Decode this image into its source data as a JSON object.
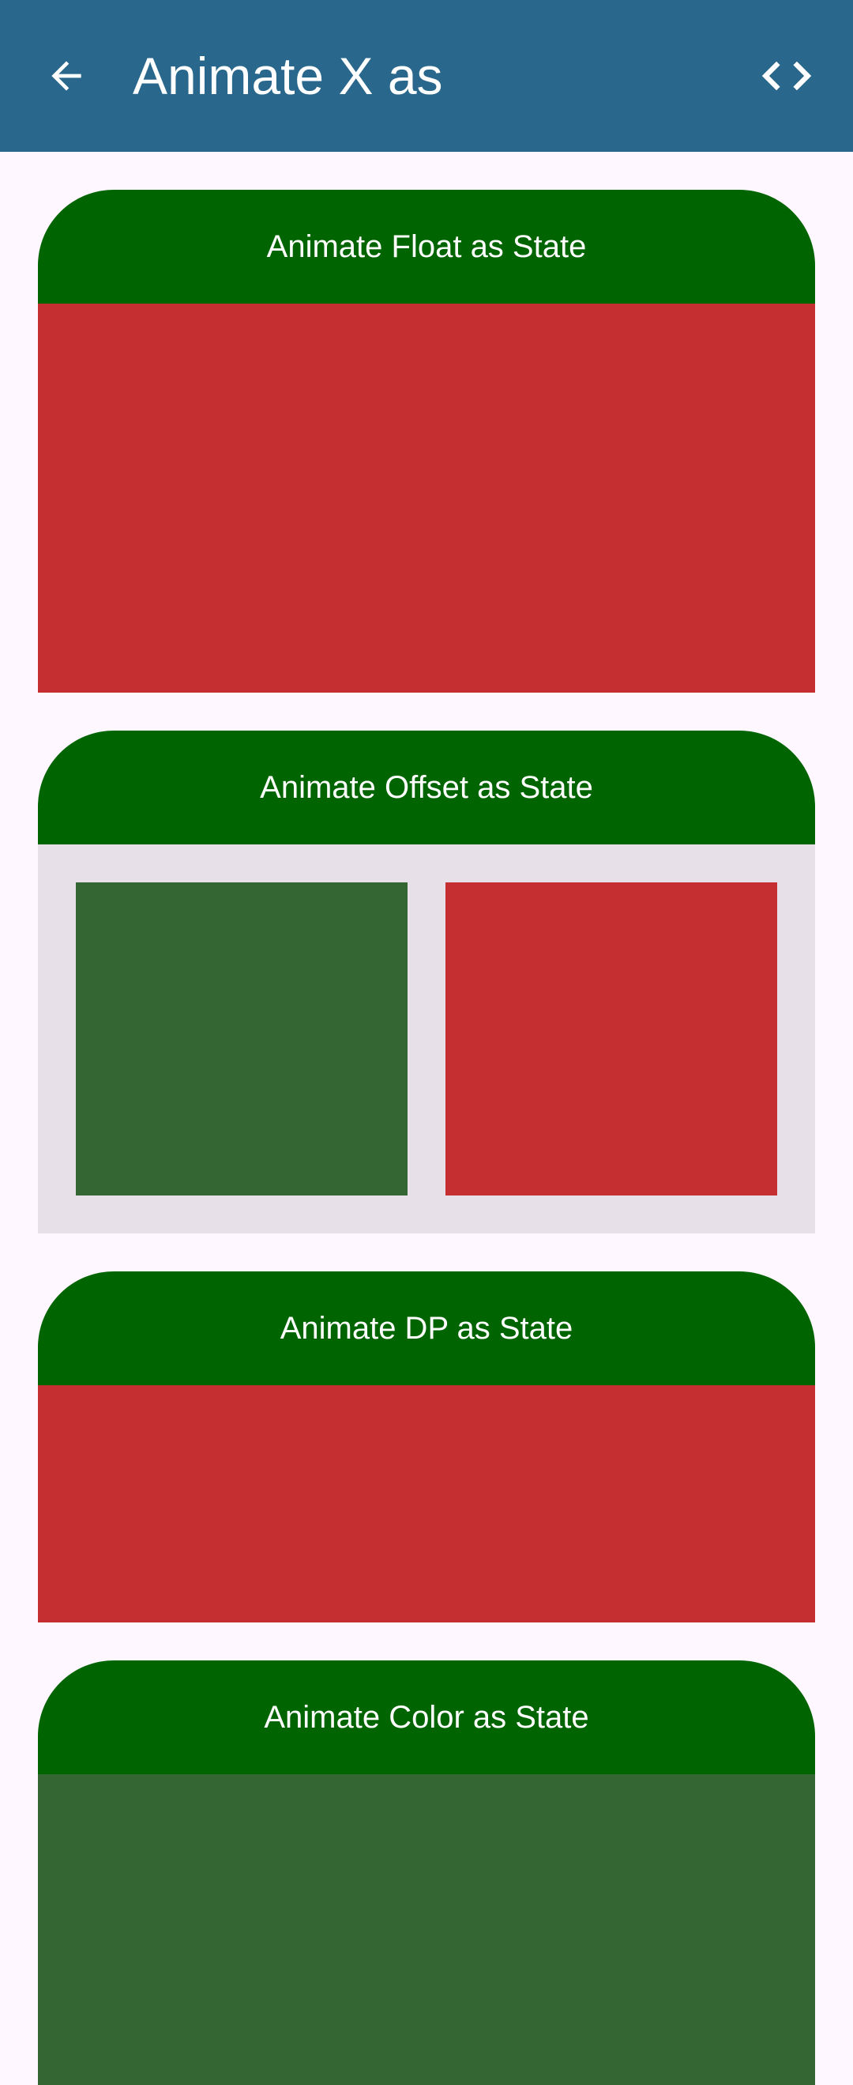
{
  "app_bar": {
    "title": "Animate X as",
    "back_icon": "arrow-back-icon",
    "code_icon": "code-icon",
    "background": "#29678C"
  },
  "cards": [
    {
      "title": "Animate Float as State",
      "header_color": "#006400",
      "body_color": "#C62F31"
    },
    {
      "title": "Animate Offset as State",
      "header_color": "#006400",
      "body_color": "#E7E0E8",
      "boxes": [
        {
          "color": "#336633"
        },
        {
          "color": "#C62F31"
        }
      ]
    },
    {
      "title": "Animate DP as State",
      "header_color": "#006400",
      "body_color": "#C62F31"
    },
    {
      "title": "Animate Color as State",
      "header_color": "#006400",
      "body_color": "#336633"
    }
  ]
}
